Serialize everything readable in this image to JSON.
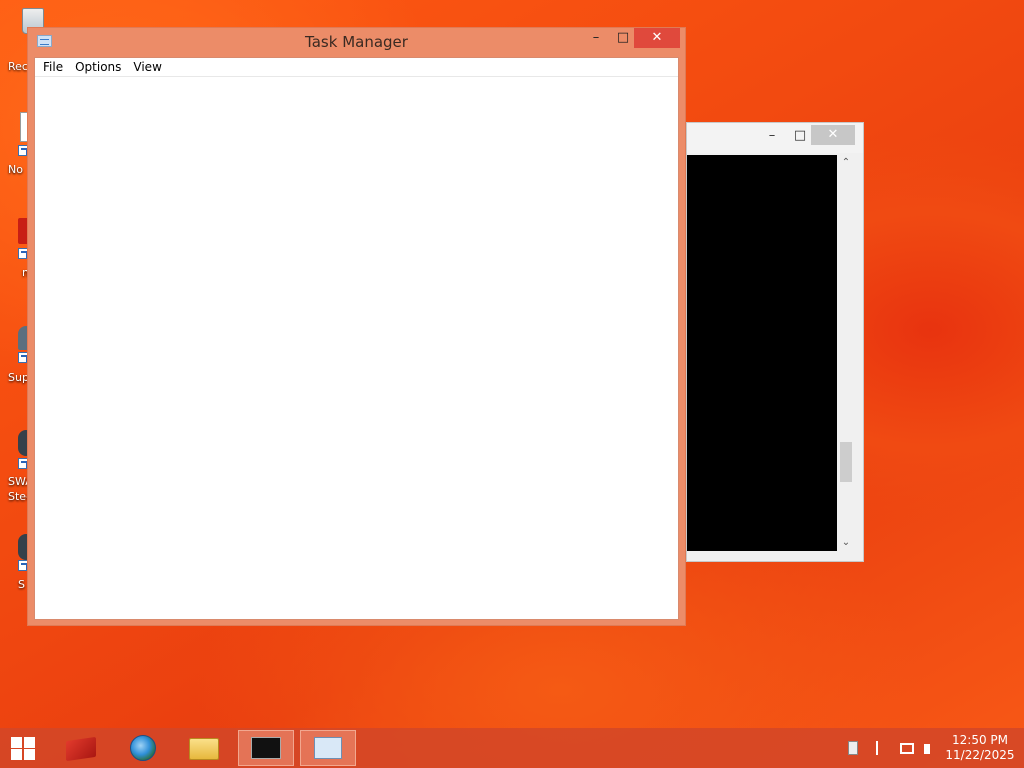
{
  "desktop": {
    "icons": [
      {
        "label": "Rec"
      },
      {
        "label": "No"
      },
      {
        "label": "n"
      },
      {
        "label": "Sup"
      },
      {
        "label": "SWA\nStee"
      },
      {
        "label": "S"
      }
    ]
  },
  "console_window": {
    "minimize": "–",
    "maximize": "□",
    "close": "✕",
    "scroll_up": "⌃",
    "scroll_down": "⌄"
  },
  "task_manager": {
    "title": "Task Manager",
    "title_icon": "task-manager-icon",
    "minimize": "–",
    "maximize": "□",
    "close": "✕",
    "menu": [
      "File",
      "Options",
      "View"
    ]
  },
  "taskbar": {
    "items": [
      {
        "name": "start",
        "icon": "windows-logo-icon"
      },
      {
        "name": "app-red",
        "icon": "red-app-icon"
      },
      {
        "name": "browser",
        "icon": "browser-icon"
      },
      {
        "name": "file-explorer",
        "icon": "folder-icon"
      },
      {
        "name": "command-prompt",
        "icon": "cmd-icon",
        "active": true
      },
      {
        "name": "task-manager",
        "icon": "task-manager-icon",
        "active": true
      }
    ],
    "clock": {
      "time": "12:50 PM",
      "date": "11/22/2025"
    },
    "colors": {
      "accent": "#e0493c",
      "taskbar": "#d24628"
    }
  }
}
